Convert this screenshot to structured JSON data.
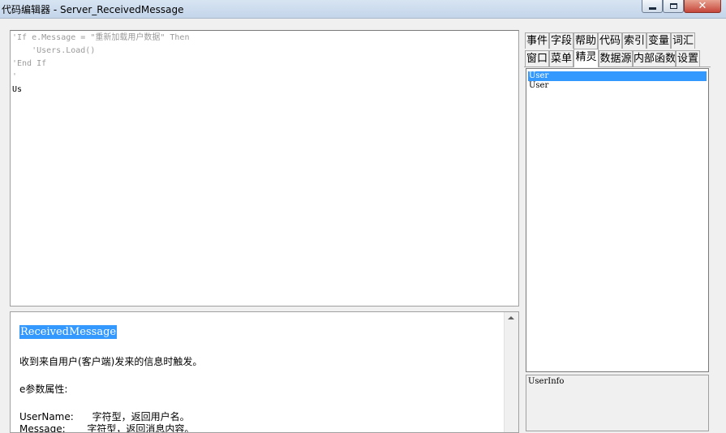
{
  "window": {
    "title": "代码编辑器 - Server_ReceivedMessage",
    "close_glyph": "✕"
  },
  "editor": {
    "lines": [
      "'If e.Message = \"重新加载用户数据\" Then",
      "    'Users.Load()",
      "'End If",
      "'",
      "Us"
    ]
  },
  "help": {
    "title": "ReceivedMessage",
    "description": "收到来自用户(客户端)发来的信息时触发。",
    "param_heading": "e参数属性:",
    "params": [
      "UserName:      字符型，返回用户名。",
      "Message:       字符型，返回消息内容。"
    ]
  },
  "tabs": {
    "row1": [
      "事件",
      "字段",
      "帮助",
      "代码",
      "索引",
      "变量",
      "词汇"
    ],
    "row2": [
      "窗口",
      "菜单",
      "精灵",
      "数据源",
      "内部函数",
      "设置"
    ],
    "active": "精灵"
  },
  "list": {
    "items": [
      "User",
      "User"
    ],
    "selected_index": 0
  },
  "info": {
    "text": "UserInfo"
  }
}
